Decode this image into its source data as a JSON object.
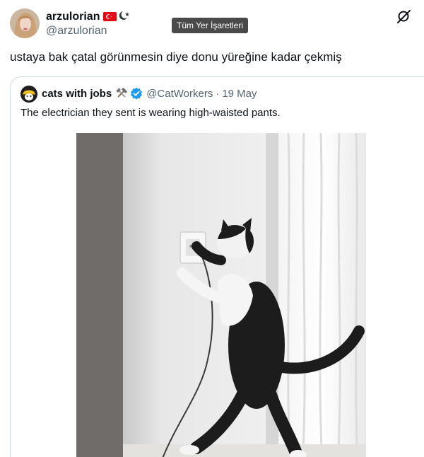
{
  "tweet": {
    "author_name": "arzulorian",
    "author_handle": "@arzulorian",
    "text": "ustaya bak çatal görünmesin diye donu yüreğine kadar çekmiş"
  },
  "tooltip": {
    "label": "Tüm Yer İşaretleri"
  },
  "icons": {
    "flag": "turkey-flag-icon",
    "badge": "star-crescent-icon",
    "grok": "grok-icon",
    "tools": "hammer-wrench-icon",
    "verified": "verified-badge-icon"
  },
  "quoted_tweet": {
    "author_name": "cats with jobs",
    "author_handle": "@CatWorkers",
    "separator": "·",
    "date": "19 May",
    "text": "The electrician they sent is wearing high-waisted pants."
  },
  "colors": {
    "accent_verified": "#1d9bf0",
    "muted_text": "#536471",
    "flag_red": "#e30a17"
  }
}
